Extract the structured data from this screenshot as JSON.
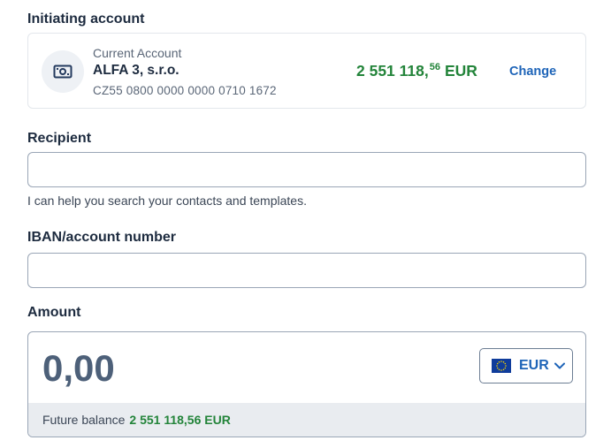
{
  "initiating_account": {
    "section_label": "Initiating account",
    "account_type": "Current Account",
    "account_name": "ALFA 3, s.r.o.",
    "iban": "CZ55 0800 0000 0000 0710 1672",
    "balance_main": "2 551 118,",
    "balance_decimals": "56",
    "balance_currency": "EUR",
    "change_label": "Change",
    "icon": "banknote-icon"
  },
  "recipient": {
    "section_label": "Recipient",
    "value": "",
    "helper_text": "I can help you search your contacts and templates."
  },
  "iban_field": {
    "section_label": "IBAN/account number",
    "value": ""
  },
  "amount": {
    "section_label": "Amount",
    "value": "0,00",
    "currency": "EUR",
    "currency_icon": "eu-flag-icon",
    "future_balance_label": "Future balance",
    "future_balance_value": "2 551 118,56 EUR"
  },
  "colors": {
    "accent_blue": "#1e64b8",
    "positive_green": "#23843a",
    "text_dark": "#1d2b3f"
  }
}
